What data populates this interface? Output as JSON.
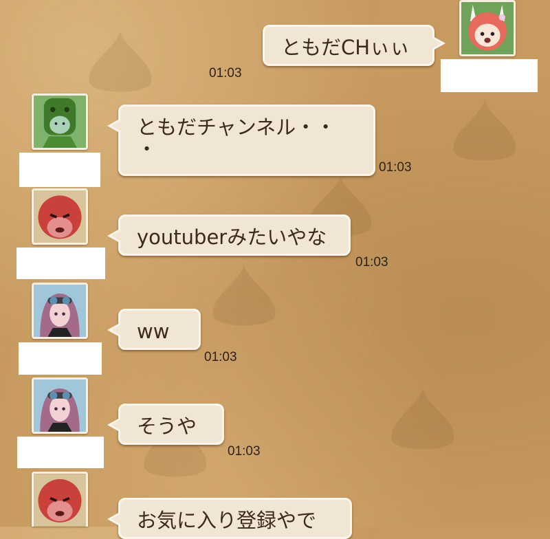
{
  "colors": {
    "background": "#c79a5f",
    "bubble": "#f1e6d3",
    "bubble_border": "#fbf6ec",
    "text": "#3b2a1a",
    "name_plate": "#ffffff"
  },
  "messages": [
    {
      "id": 1,
      "side": "right",
      "avatar": "pink-haired-creature-avatar",
      "text": "ともだCHぃぃ",
      "time": "01:03"
    },
    {
      "id": 2,
      "side": "left",
      "avatar": "green-cactus-helmet-avatar",
      "text": "ともだチャンネル・・\n・",
      "time": "01:03"
    },
    {
      "id": 3,
      "side": "left",
      "avatar": "red-round-ogre-avatar",
      "text": "youtuberみたいやな",
      "time": "01:03"
    },
    {
      "id": 4,
      "side": "left",
      "avatar": "elf-girl-goggles-avatar",
      "text": "ww",
      "time": "01:03"
    },
    {
      "id": 5,
      "side": "left",
      "avatar": "elf-girl-goggles-avatar",
      "text": "そうや",
      "time": "01:03"
    },
    {
      "id": 6,
      "side": "left",
      "avatar": "red-round-ogre-avatar",
      "text": "お気に入り登録やで",
      "time": ""
    }
  ]
}
